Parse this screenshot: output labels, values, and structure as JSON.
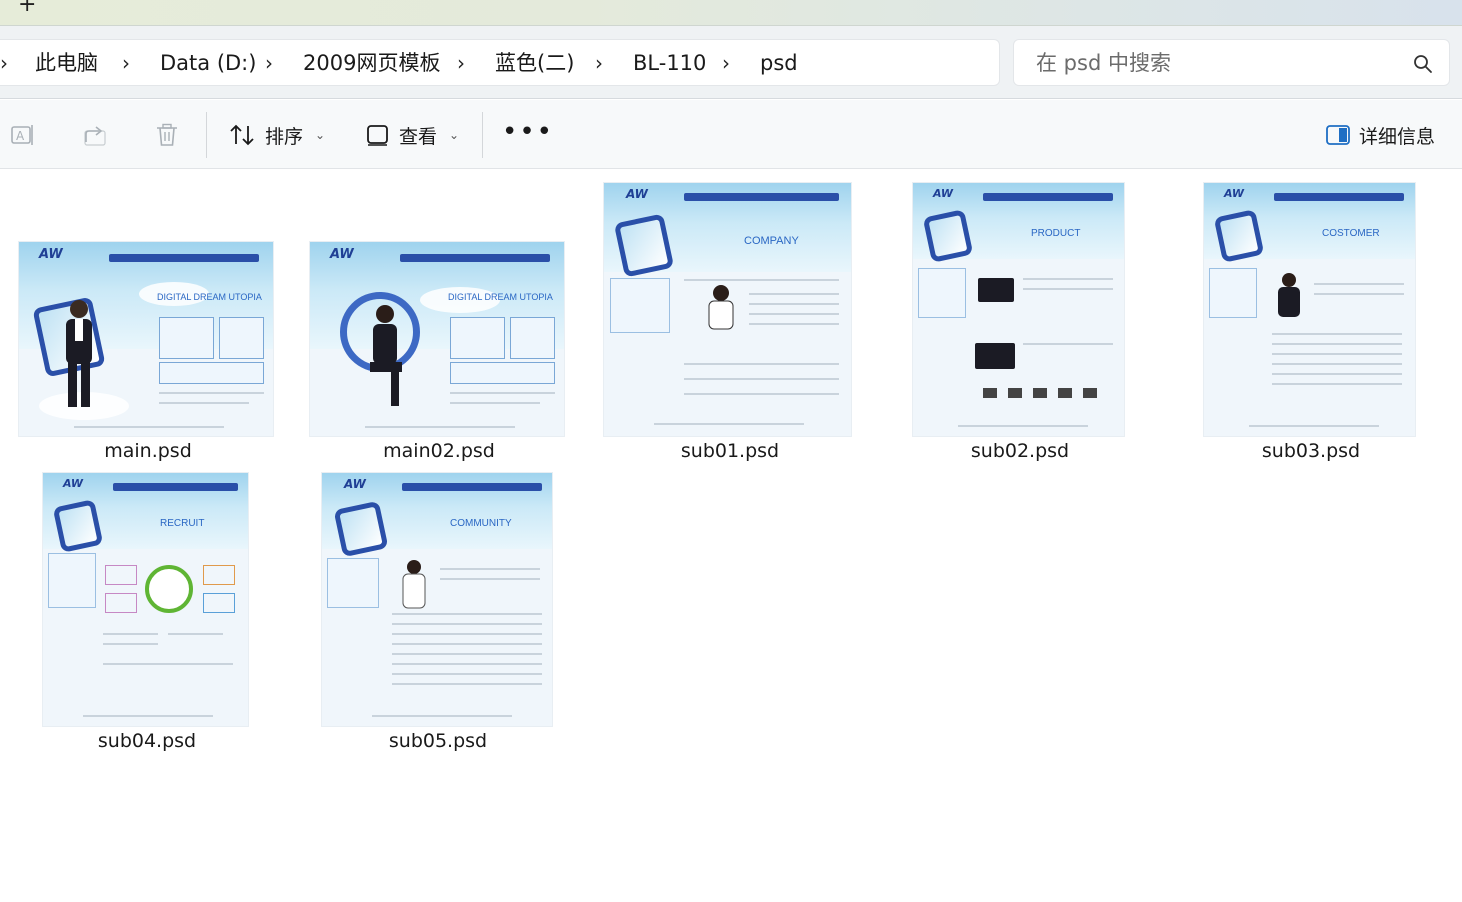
{
  "tabstrip": {
    "new_tab_symbol": "+"
  },
  "address": {
    "crumbs": [
      "此电脑",
      "Data (D:)",
      "2009网页模板",
      "蓝色(二)",
      "BL-110",
      "psd"
    ]
  },
  "search": {
    "placeholder": "在 psd 中搜索"
  },
  "commandbar": {
    "sort_label": "排序",
    "view_label": "查看",
    "more_label": "•••",
    "details_label": "详细信息"
  },
  "files": [
    {
      "name": "main.psd",
      "headline": "DIGITAL DREAM UTOPIA"
    },
    {
      "name": "main02.psd",
      "headline": "DIGITAL DREAM UTOPIA"
    },
    {
      "name": "sub01.psd",
      "headline": "COMPANY"
    },
    {
      "name": "sub02.psd",
      "headline": "PRODUCT"
    },
    {
      "name": "sub03.psd",
      "headline": "COSTOMER"
    },
    {
      "name": "sub04.psd",
      "headline": "RECRUIT"
    },
    {
      "name": "sub05.psd",
      "headline": "COMMUNITY"
    }
  ],
  "thumbnail_logo": "AW",
  "colors": {
    "accent": "#2a4fa8",
    "sky": "#9fd3ee",
    "headline": "#2a67c4"
  },
  "icons": [
    "new-tab-icon",
    "chevron-right-icon",
    "search-icon",
    "rename-icon",
    "share-icon",
    "delete-icon",
    "sort-icon",
    "view-icon",
    "details-pane-icon"
  ]
}
